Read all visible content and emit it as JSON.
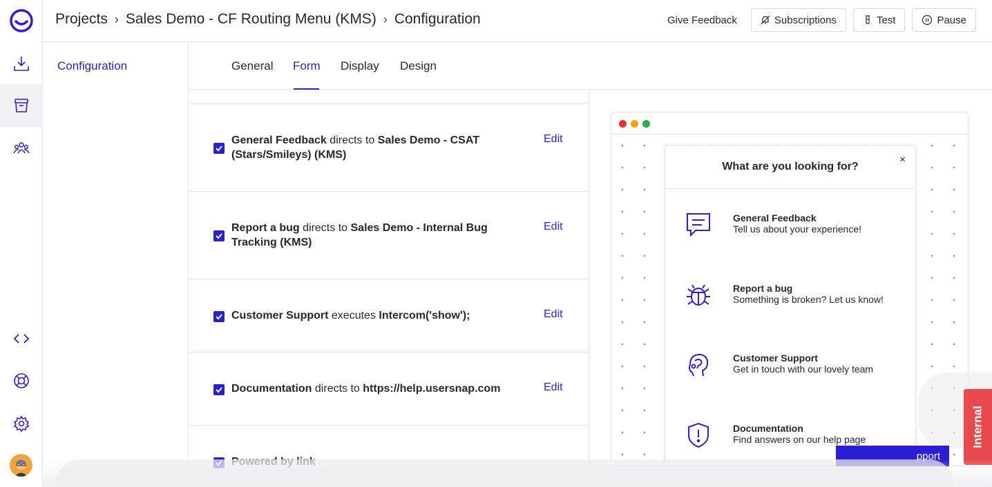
{
  "header": {
    "breadcrumbs": [
      "Projects",
      "Sales Demo - CF Routing Menu (KMS)",
      "Configuration"
    ],
    "give_feedback": "Give Feedback",
    "subscriptions": "Subscriptions",
    "test": "Test",
    "pause": "Pause"
  },
  "rail": {
    "icons": [
      "usersnap-logo-icon",
      "download-icon",
      "archive-icon",
      "team-icon",
      "code-icon",
      "lifebuoy-icon",
      "gear-icon",
      "avatar"
    ]
  },
  "subnav": {
    "items": [
      {
        "label": "Configuration"
      }
    ]
  },
  "tabs": [
    {
      "label": "General"
    },
    {
      "label": "Form"
    },
    {
      "label": "Display"
    },
    {
      "label": "Design"
    }
  ],
  "active_tab": "Form",
  "routing": {
    "edit_label": "Edit",
    "items": [
      {
        "name": "General Feedback",
        "verb": "directs to",
        "target": "Sales Demo - CSAT (Stars/Smileys) (KMS)",
        "checked": true
      },
      {
        "name": "Report a bug",
        "verb": "directs to",
        "target": "Sales Demo - Internal Bug Tracking (KMS)",
        "checked": true
      },
      {
        "name": "Customer Support",
        "verb": "executes",
        "target": "Intercom('show');",
        "checked": true
      },
      {
        "name": "Documentation",
        "verb": "directs to",
        "target": "https://help.usersnap.com",
        "checked": true
      },
      {
        "name": "Powered by link",
        "verb": "",
        "target": "",
        "checked": true
      }
    ]
  },
  "preview": {
    "title": "What are you looking for?",
    "close": "×",
    "items": [
      {
        "name": "General Feedback",
        "desc": "Tell us about your experience!",
        "icon": "chat-icon"
      },
      {
        "name": "Report a bug",
        "desc": "Something is broken? Let us know!",
        "icon": "bug-icon"
      },
      {
        "name": "Customer Support",
        "desc": "Get in touch with our lovely team",
        "icon": "support-icon"
      },
      {
        "name": "Documentation",
        "desc": "Find answers on our help page",
        "icon": "shield-icon"
      }
    ],
    "support_button": "pport",
    "internal_tab": "Internal"
  },
  "colors": {
    "accent": "#2a1fd4",
    "internal": "#e8494f",
    "traffic": [
      "#e8332b",
      "#f0a30a",
      "#28b04a"
    ]
  }
}
